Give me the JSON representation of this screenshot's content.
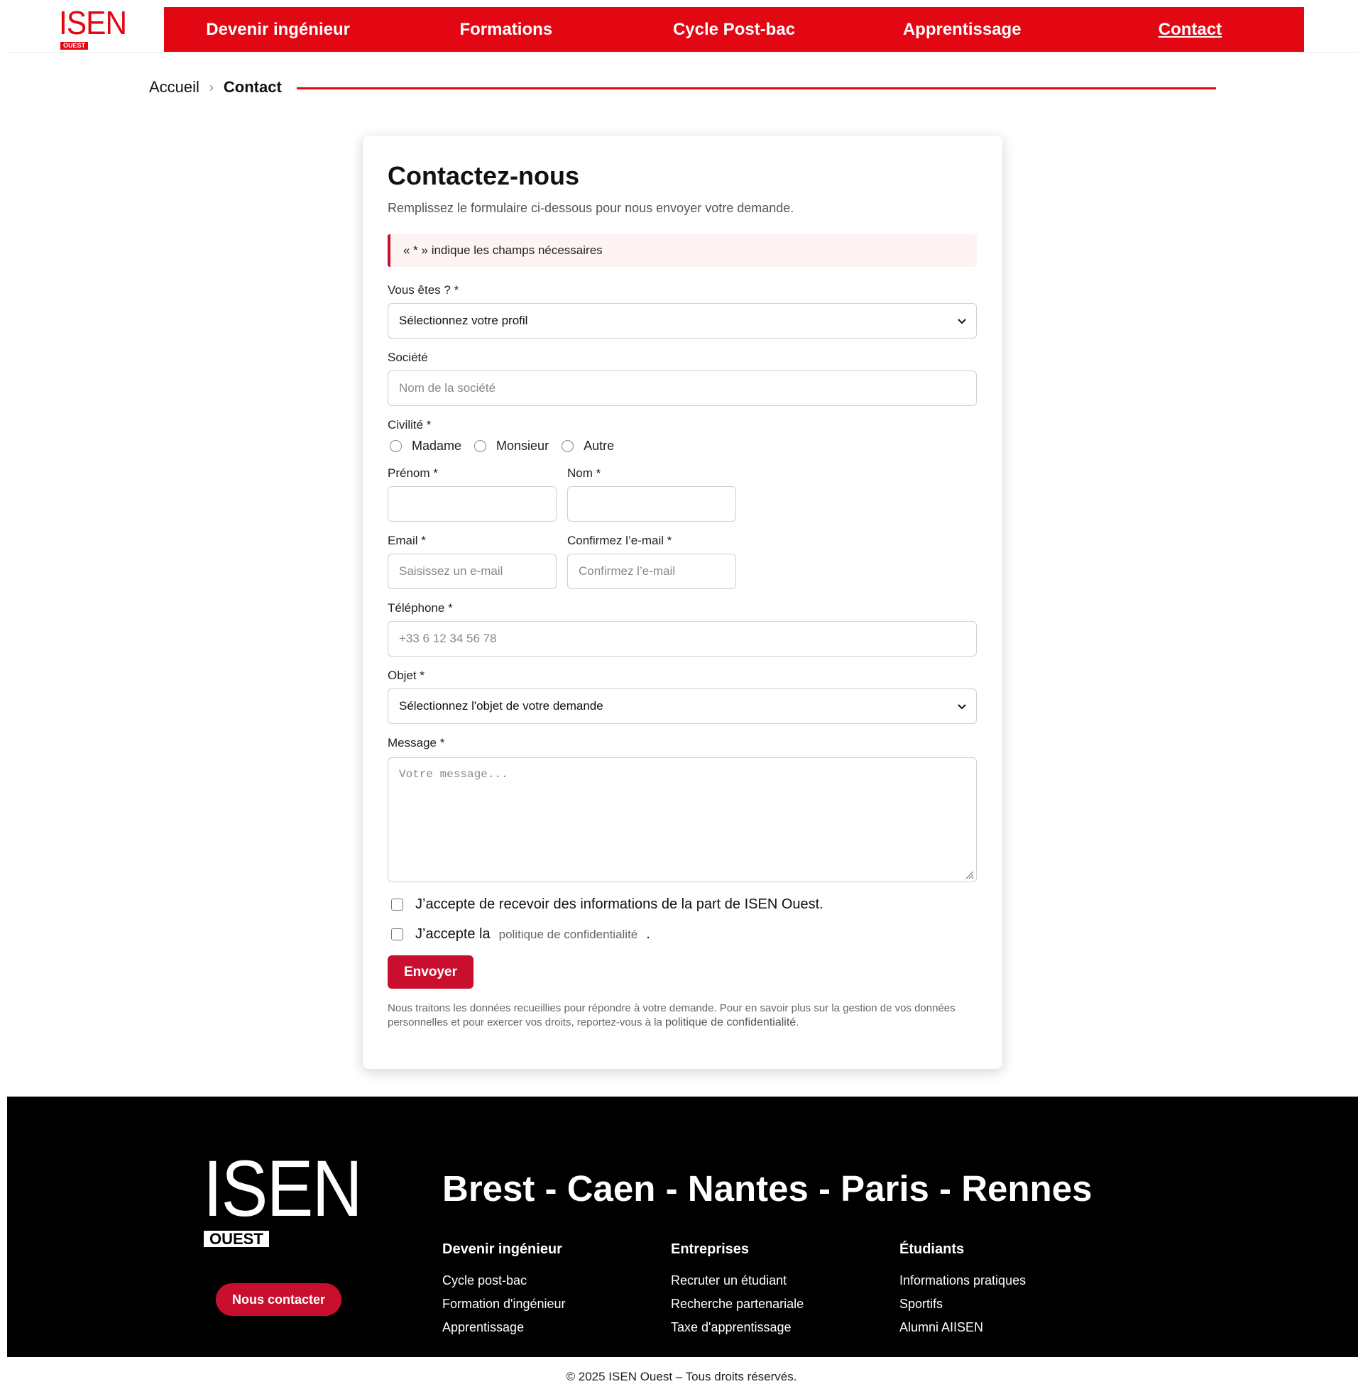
{
  "brand": {
    "logo_word": "ISEN",
    "logo_sub": "OUEST",
    "accent": "#e30613",
    "button": "#c8102e"
  },
  "nav": {
    "items": [
      {
        "label": "Devenir ingénieur"
      },
      {
        "label": "Formations"
      },
      {
        "label": "Cycle Post-bac"
      },
      {
        "label": "Apprentissage"
      },
      {
        "label": "Contact"
      }
    ]
  },
  "breadcrumb": {
    "home": "Accueil",
    "separator": "›",
    "current": "Contact"
  },
  "form": {
    "title": "Contactez-nous",
    "subtitle": "Remplissez le formulaire ci-dessous pour nous envoyer votre demande.",
    "notice": "« * » indique les champs nécessaires",
    "profile": {
      "label": "Vous êtes ? *",
      "value": "Sélectionnez votre profil"
    },
    "company": {
      "label": "Société",
      "placeholder": "Nom de la société"
    },
    "civility": {
      "label": "Civilité *",
      "options": [
        "Madame",
        "Monsieur",
        "Autre"
      ]
    },
    "firstname": {
      "label": "Prénom *"
    },
    "lastname": {
      "label": "Nom *"
    },
    "email": {
      "label": "Email *",
      "placeholder": "Saisissez un e-mail"
    },
    "email_confirm": {
      "label": "Confirmez l’e-mail *",
      "placeholder": "Confirmez l’e-mail"
    },
    "phone": {
      "label": "Téléphone *",
      "placeholder": "+33 6 12 34 56 78"
    },
    "subject": {
      "label": "Objet *",
      "value": "Sélectionnez l'objet de votre demande"
    },
    "message": {
      "label": "Message *",
      "placeholder": "Votre message..."
    },
    "consent_info": "J’accepte de recevoir des informations de la part de ISEN Ouest.",
    "consent_policy_prefix": "J’accepte la",
    "consent_policy_link": "politique de confidentialité",
    "consent_policy_suffix": ".",
    "submit": "Envoyer",
    "legal_text": "Nous traitons les données recueillies pour répondre à votre demande. Pour en savoir plus sur la gestion de vos données personnelles et pour exercer vos droits, reportez-vous à la",
    "legal_link": "politique de confidentialité",
    "legal_end": "."
  },
  "footer": {
    "logo_word": "ISEN",
    "logo_sub": "OUEST",
    "contact_button": "Nous contacter",
    "cities": "Brest - Caen - Nantes - Paris - Rennes",
    "columns": [
      {
        "title": "Devenir ingénieur",
        "links": [
          "Cycle post-bac",
          "Formation d'ingénieur",
          "Apprentissage"
        ]
      },
      {
        "title": "Entreprises",
        "links": [
          "Recruter un étudiant",
          "Recherche partenariale",
          "Taxe d'apprentissage"
        ]
      },
      {
        "title": "Étudiants",
        "links": [
          "Informations pratiques",
          "Sportifs",
          "Alumni AIISEN"
        ]
      }
    ],
    "copyright": "© 2025 ISEN Ouest – Tous droits réservés."
  }
}
